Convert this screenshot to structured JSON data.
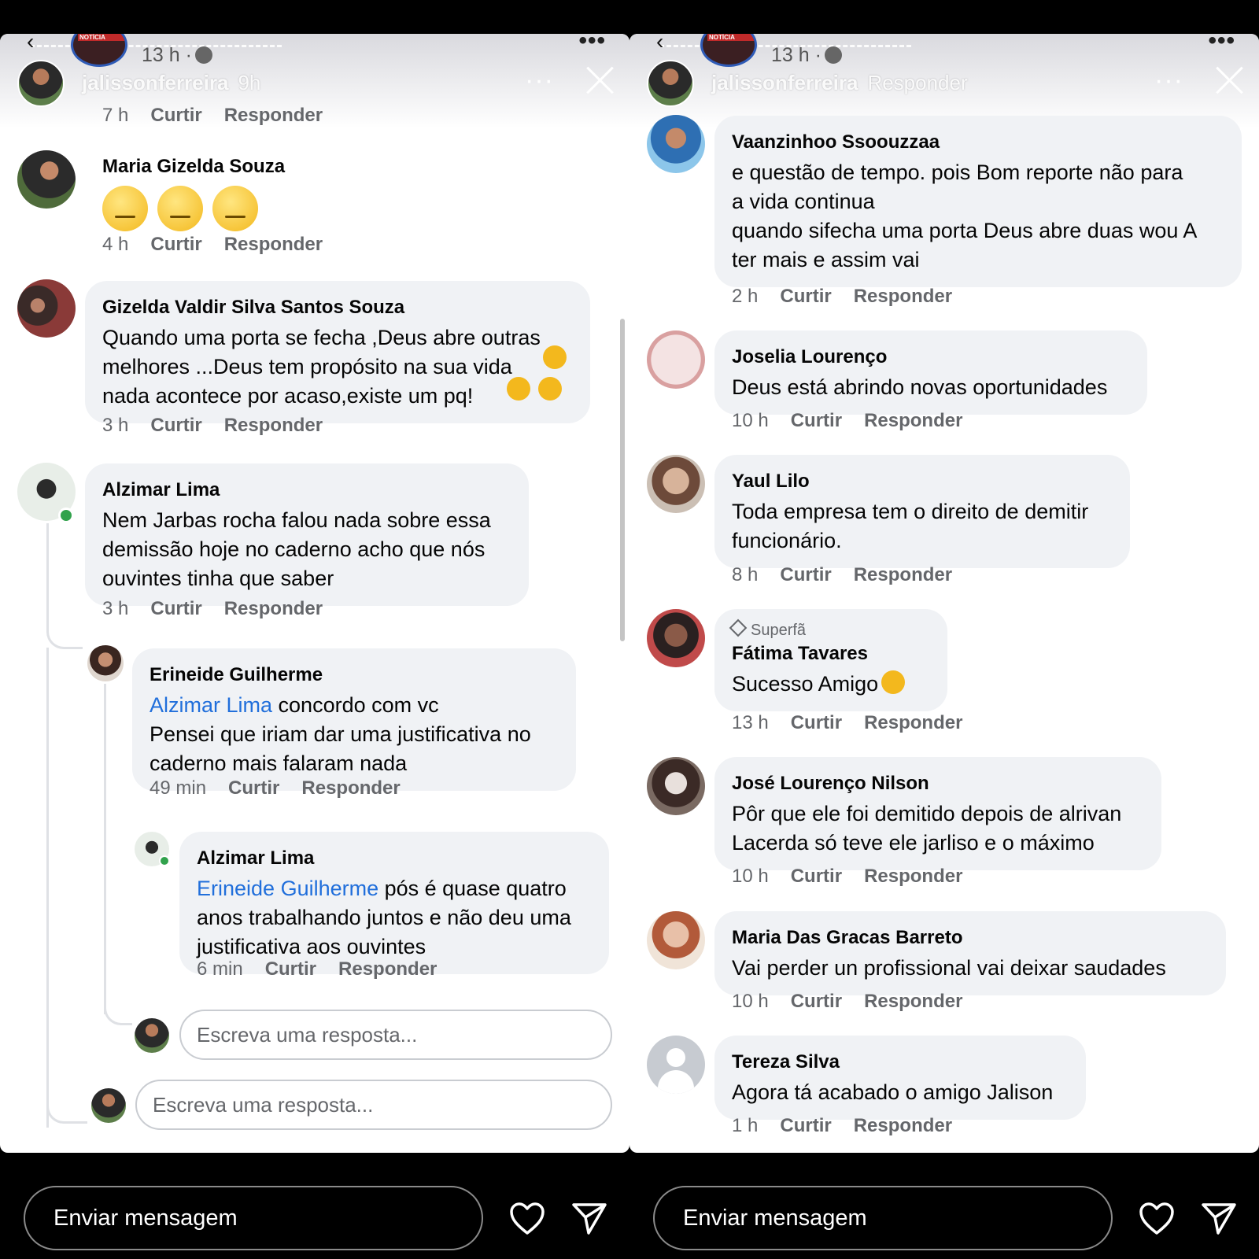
{
  "story": {
    "post_time": "13 h ·",
    "username": "jalissonferreira",
    "age": "9h",
    "message_placeholder": "Enviar mensagem"
  },
  "left": {
    "top_actions": {
      "time": "7 h",
      "like": "Curtir",
      "reply": "Responder"
    },
    "comments": [
      {
        "name": "Maria Gizelda Souza",
        "time": "4 h",
        "like": "Curtir",
        "reply": "Responder"
      },
      {
        "name": "Gizelda Valdir Silva Santos Souza",
        "text": "Quando uma porta se fecha ,Deus abre outras\nmelhores ...Deus tem propósito na sua vida\nnada acontece por acaso,existe um pq!",
        "time": "3 h",
        "like": "Curtir",
        "reply": "Responder"
      },
      {
        "name": "Alzimar Lima",
        "text": "Nem Jarbas rocha falou nada sobre essa\ndemissão hoje no caderno acho que nós\nouvintes tinha que saber",
        "time": "3 h",
        "like": "Curtir",
        "reply": "Responder"
      },
      {
        "name": "Erineide Guilherme",
        "mention": "Alzimar Lima",
        "text_after_mention": " concordo  com vc",
        "text": "Pensei que iriam dar  uma justificativa no\ncaderno mais falaram nada",
        "time": "49 min",
        "like": "Curtir",
        "reply": "Responder"
      },
      {
        "name": "Alzimar Lima",
        "mention": "Erineide Guilherme",
        "text_after_mention": " pós é quase quatro",
        "text": "anos trabalhando juntos e não deu uma\njustificativa aos ouvintes",
        "time": "6 min",
        "like": "Curtir",
        "reply": "Responder"
      }
    ],
    "reply_placeholder": "Escreva uma resposta..."
  },
  "right": {
    "header_overlap": "Responder",
    "comments": [
      {
        "name": "Vaanzinhoo Ssoouzzaa",
        "text": "e questão de tempo. pois Bom reporte não para\na vida continua\nquando sifecha uma porta Deus abre duas wou A\nter mais  e assim vai",
        "time": "2 h",
        "like": "Curtir",
        "reply": "Responder"
      },
      {
        "name": "Joselia Lourenço",
        "text": "Deus está abrindo novas oportunidades",
        "time": "10 h",
        "like": "Curtir",
        "reply": "Responder"
      },
      {
        "name": "Yaul Lilo",
        "text": "Toda empresa tem o direito de demitir\nfuncionário.",
        "time": "8 h",
        "like": "Curtir",
        "reply": "Responder"
      },
      {
        "badge": "Superfã",
        "name": "Fátima Tavares",
        "text": "Sucesso  Amigo",
        "time": "13 h",
        "like": "Curtir",
        "reply": "Responder"
      },
      {
        "name": "José Lourenço Nilson",
        "text": "Pôr que ele foi demitido depois de alrivan\nLacerda só teve ele jarliso e o máximo",
        "time": "10 h",
        "like": "Curtir",
        "reply": "Responder"
      },
      {
        "name": "Maria Das Gracas Barreto",
        "text": "Vai perder  un profissional  vai deixar  saudades",
        "time": "10 h",
        "like": "Curtir",
        "reply": "Responder"
      },
      {
        "name": "Tereza Silva",
        "text": "Agora tá acabado o amigo Jalison",
        "time": "1 h",
        "like": "Curtir",
        "reply": "Responder"
      }
    ]
  },
  "colors": {
    "mention": "#216fdb",
    "bubble": "#f0f2f5",
    "meta": "#65676b",
    "online": "#31a24c"
  },
  "icons": [
    "back-arrow-icon",
    "globe-icon",
    "more-icon",
    "close-icon",
    "heart-icon",
    "send-icon",
    "diamond-icon"
  ]
}
